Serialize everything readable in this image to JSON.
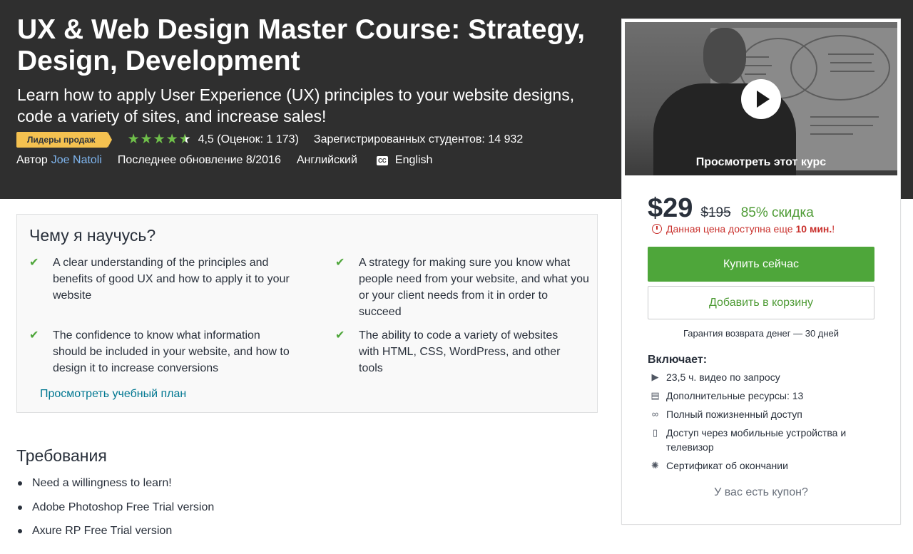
{
  "course": {
    "title": "UX & Web Design Master Course: Strategy, Design, Development",
    "subtitle": "Learn how to apply User Experience (UX) principles to your website designs, code a variety of sites, and increase sales!",
    "badge": "Лидеры продаж",
    "rating": {
      "value": 4.5,
      "text": "4,5 (Оценок: 1 173)"
    },
    "students": "Зарегистрированных студентов: 14 932",
    "author_prefix": "Автор",
    "author_name": "Joe Natoli",
    "updated": "Последнее обновление 8/2016",
    "language": "Английский",
    "cc_icon_text": "CC",
    "captions": "English"
  },
  "sidebar": {
    "preview_label": "Просмотреть этот курс",
    "price": "$29",
    "old_price": "$195",
    "discount": "85% скидка",
    "timer_text": "Данная цена доступна еще",
    "timer_strong": "10 мин.",
    "timer_suffix": "!",
    "buy_label": "Купить сейчас",
    "cart_label": "Добавить в корзину",
    "guarantee": "Гарантия возврата денег — 30 дней",
    "includes_title": "Включает:",
    "includes": [
      {
        "icon": "video-icon",
        "text": "23,5 ч. видео по запросу"
      },
      {
        "icon": "document-icon",
        "text": "Дополнительные ресурсы: 13"
      },
      {
        "icon": "infinity-icon",
        "text": "Полный пожизненный доступ"
      },
      {
        "icon": "mobile-icon",
        "text": "Доступ через мобильные устройства и телевизор"
      },
      {
        "icon": "certificate-icon",
        "text": "Сертификат об окончании"
      }
    ],
    "coupon": "У вас есть купон?"
  },
  "learn": {
    "title": "Чему я научусь?",
    "items": [
      "A clear understanding of the principles and benefits of good UX and how to apply it to your website",
      "A strategy for making sure you know what people need from your website, and what you or your client needs from it in order to succeed",
      "The confidence to know what information should be included in your website, and how to design it to increase conversions",
      "The ability to code a variety of websites with HTML, CSS, WordPress, and other tools"
    ],
    "curriculum_link": "Просмотреть учебный план"
  },
  "requirements": {
    "title": "Требования",
    "items": [
      "Need a willingness to learn!",
      "Adobe Photoshop Free Trial version",
      "Axure RP Free Trial version"
    ]
  },
  "colors": {
    "hero_bg": "#2f2f2f",
    "badge": "#f4c150",
    "star": "#6fbf4a",
    "buy_button": "#4ea63a",
    "discount": "#4e9b35",
    "timer": "#c9302c",
    "link": "#007791"
  }
}
